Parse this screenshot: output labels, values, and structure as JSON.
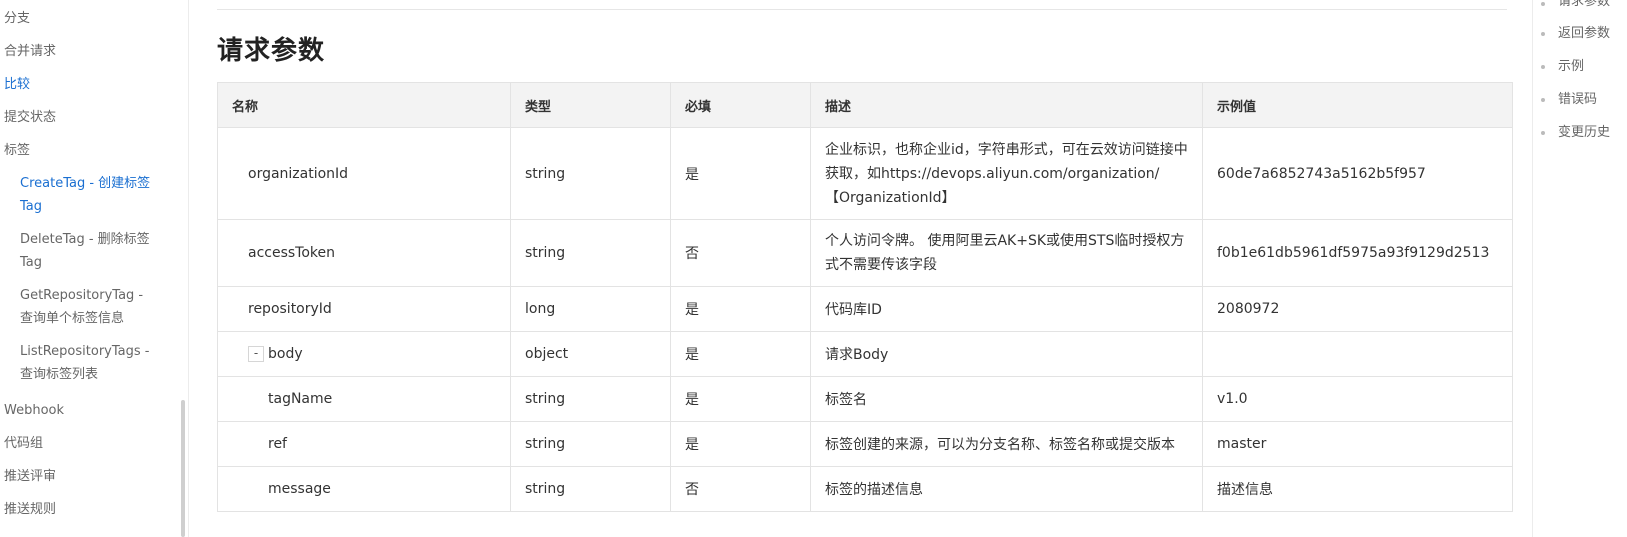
{
  "sidebar": {
    "items": [
      {
        "label": "分支"
      },
      {
        "label": "合并请求"
      },
      {
        "label": "比较"
      },
      {
        "label": "提交状态"
      },
      {
        "label": "标签"
      }
    ],
    "sub_items": [
      {
        "label": "CreateTag - 创建标签Tag"
      },
      {
        "label": "DeleteTag - 删除标签Tag"
      },
      {
        "label": "GetRepositoryTag - 查询单个标签信息"
      },
      {
        "label": "ListRepositoryTags - 查询标签列表"
      }
    ],
    "bottom_items": [
      {
        "label": "Webhook"
      },
      {
        "label": "代码组"
      },
      {
        "label": "推送评审"
      },
      {
        "label": "推送规则"
      }
    ]
  },
  "main": {
    "heading": "请求参数",
    "columns": [
      "名称",
      "类型",
      "必填",
      "描述",
      "示例值"
    ],
    "rows": [
      {
        "name": "organizationId",
        "type": "string",
        "required": "是",
        "desc": "企业标识，也称企业id，字符串形式，可在云效访问链接中获取，如https://devops.aliyun.com/organization/【OrganizationId】",
        "example": "60de7a6852743a5162b5f957"
      },
      {
        "name": "accessToken",
        "type": "string",
        "required": "否",
        "desc": "个人访问令牌。 使用阿里云AK+SK或使用STS临时授权方式不需要传该字段",
        "example": "f0b1e61db5961df5975a93f9129d2513"
      },
      {
        "name": "repositoryId",
        "type": "long",
        "required": "是",
        "desc": "代码库ID",
        "example": "2080972"
      },
      {
        "name": "body",
        "toggle": "-",
        "type": "object",
        "required": "是",
        "desc": "请求Body",
        "example": ""
      },
      {
        "name": "tagName",
        "type": "string",
        "required": "是",
        "desc": "标签名",
        "example": "v1.0"
      },
      {
        "name": "ref",
        "type": "string",
        "required": "是",
        "desc": "标签创建的来源，可以为分支名称、标签名称或提交版本",
        "example": "master"
      },
      {
        "name": "message",
        "type": "string",
        "required": "否",
        "desc": "标签的描述信息",
        "example": "描述信息"
      }
    ]
  },
  "toc": {
    "items": [
      {
        "label": "请求参数"
      },
      {
        "label": "返回参数"
      },
      {
        "label": "示例"
      },
      {
        "label": "错误码"
      },
      {
        "label": "变更历史"
      }
    ]
  },
  "colors": {
    "accent": "#1a6fd1",
    "header_bg": "#f3f3f3",
    "border": "#e3e3e3"
  }
}
